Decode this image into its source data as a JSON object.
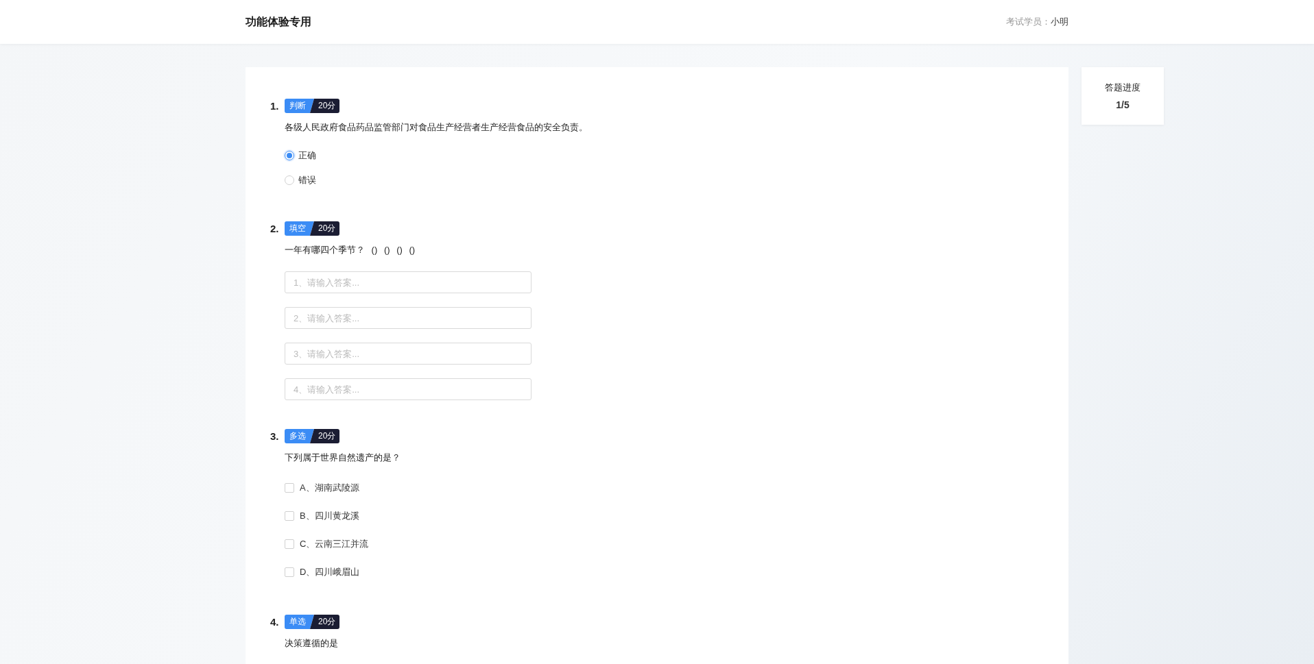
{
  "header": {
    "title": "功能体验专用",
    "user_label": "考试学员：",
    "user_name": "小明"
  },
  "questions": [
    {
      "number": "1.",
      "type": "判断",
      "score": "20分",
      "kind": "radio",
      "text": "各级人民政府食品药品监管部门对食品生产经营者生产经营食品的安全负责。",
      "options": [
        {
          "label": "正确",
          "selected": true
        },
        {
          "label": "错误",
          "selected": false
        }
      ]
    },
    {
      "number": "2.",
      "type": "填空",
      "score": "20分",
      "kind": "fill",
      "text": "一年有哪四个季节？ () () () ()",
      "blanks": [
        {
          "placeholder": "1、请输入答案..."
        },
        {
          "placeholder": "2、请输入答案..."
        },
        {
          "placeholder": "3、请输入答案..."
        },
        {
          "placeholder": "4、请输入答案..."
        }
      ]
    },
    {
      "number": "3.",
      "type": "多选",
      "score": "20分",
      "kind": "checkbox",
      "text": "下列属于世界自然遗产的是？",
      "options": [
        {
          "label": "A、湖南武陵源",
          "checked": false
        },
        {
          "label": "B、四川黄龙溪",
          "checked": false
        },
        {
          "label": "C、云南三江并流",
          "checked": false
        },
        {
          "label": "D、四川峨眉山",
          "checked": false
        }
      ]
    },
    {
      "number": "4.",
      "type": "单选",
      "score": "20分",
      "kind": "radio",
      "text": "决策遵循的是"
    }
  ],
  "progress": {
    "title": "答题进度",
    "value": "1/5"
  }
}
